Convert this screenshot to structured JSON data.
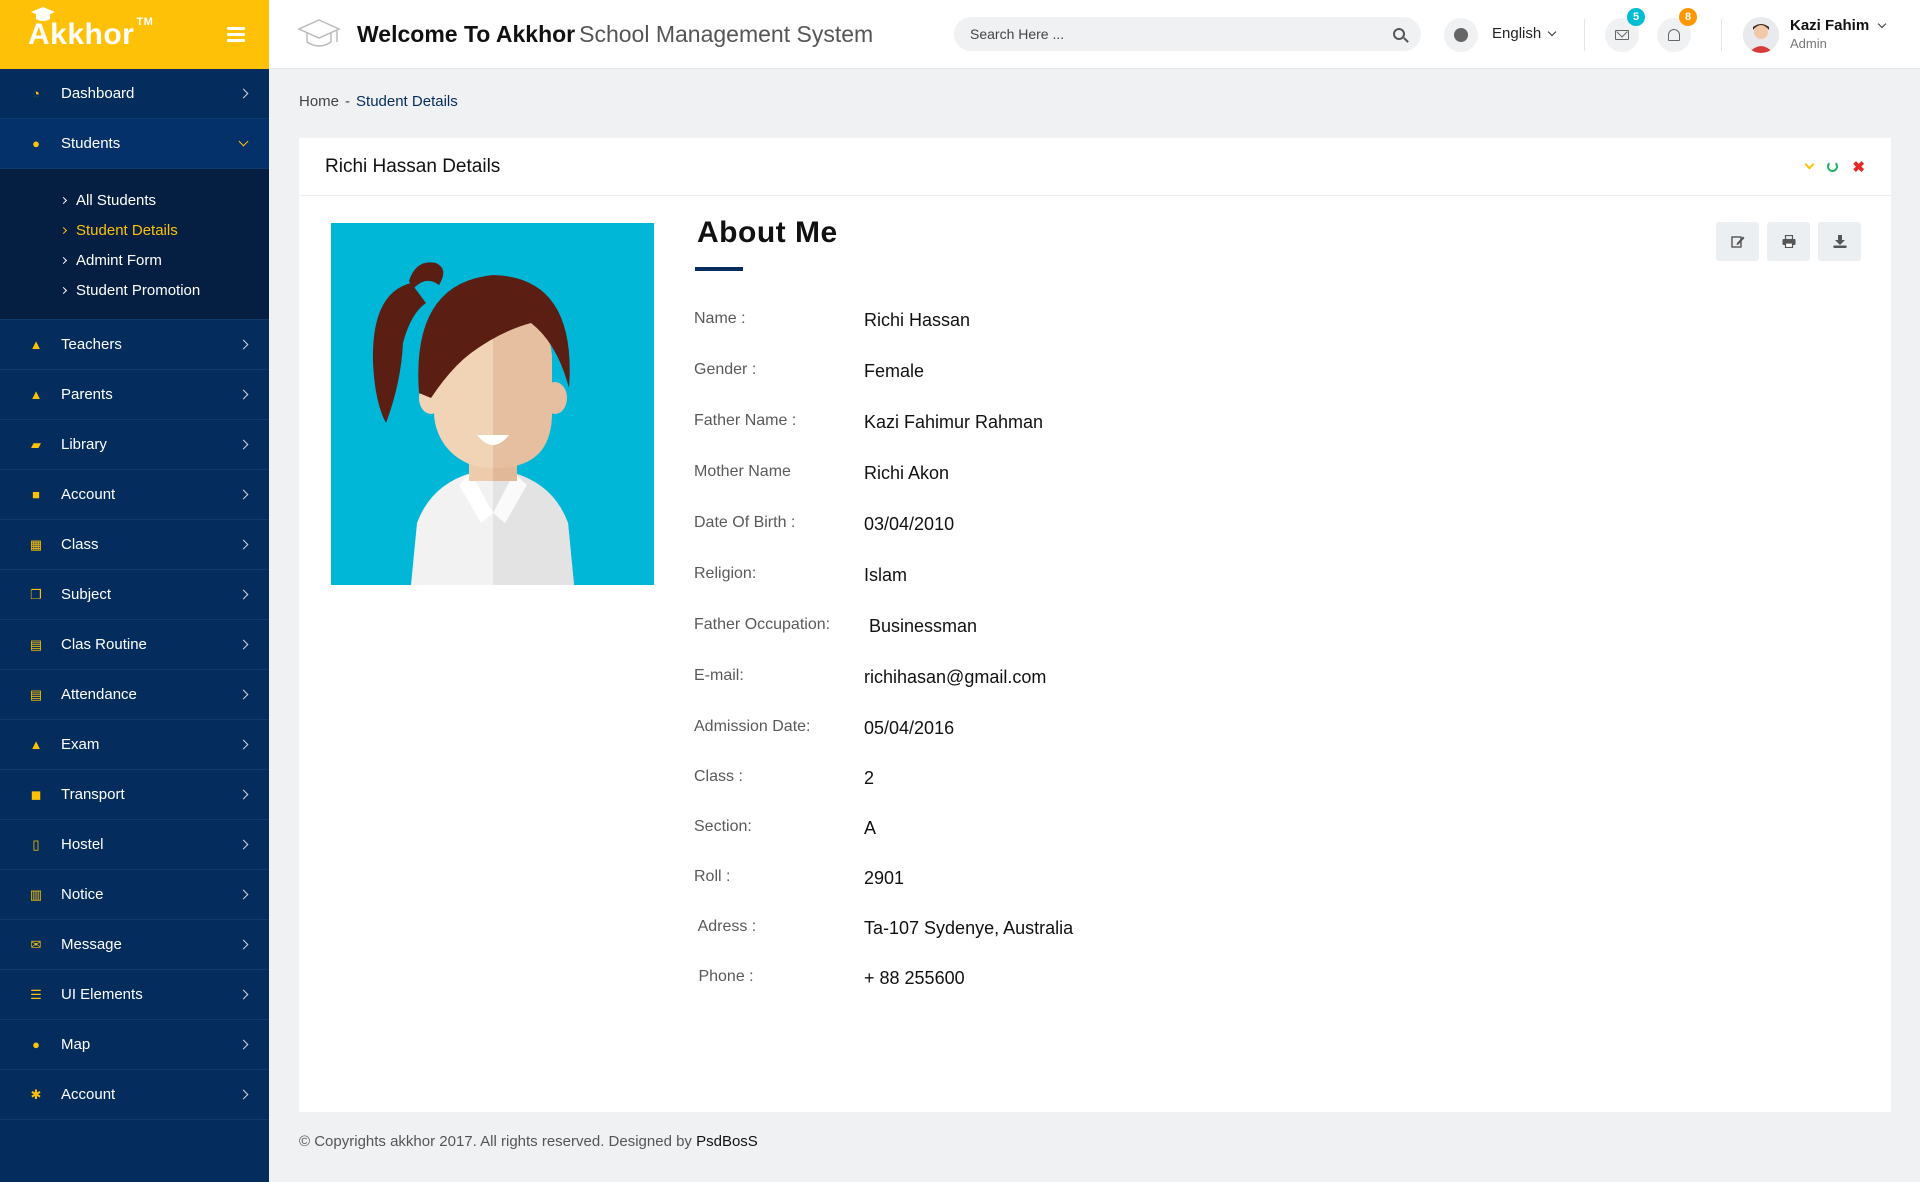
{
  "brand": {
    "name": "Akkhor",
    "tm": "TM"
  },
  "sidebar": {
    "items": [
      {
        "key": "dashboard",
        "label": "Dashboard",
        "icon": "dashboard-icon"
      },
      {
        "key": "students",
        "label": "Students",
        "icon": "students-icon",
        "open": true
      },
      {
        "key": "teachers",
        "label": "Teachers",
        "icon": "teachers-icon"
      },
      {
        "key": "parents",
        "label": "Parents",
        "icon": "parents-icon"
      },
      {
        "key": "library",
        "label": "Library",
        "icon": "book-icon"
      },
      {
        "key": "account",
        "label": "Account",
        "icon": "briefcase-icon"
      },
      {
        "key": "class",
        "label": "Class",
        "icon": "grid-icon"
      },
      {
        "key": "subject",
        "label": "Subject",
        "icon": "copy-icon"
      },
      {
        "key": "routine",
        "label": "Clas Routine",
        "icon": "calendar-icon"
      },
      {
        "key": "attendance",
        "label": "Attendance",
        "icon": "table-icon"
      },
      {
        "key": "exam",
        "label": "Exam",
        "icon": "graduation-cap-icon"
      },
      {
        "key": "transport",
        "label": "Transport",
        "icon": "car-icon"
      },
      {
        "key": "hostel",
        "label": "Hostel",
        "icon": "building-icon"
      },
      {
        "key": "notice",
        "label": "Notice",
        "icon": "map-icon"
      },
      {
        "key": "message",
        "label": "Message",
        "icon": "envelope-icon"
      },
      {
        "key": "ui",
        "label": "UI Elements",
        "icon": "list-icon"
      },
      {
        "key": "map",
        "label": "Map",
        "icon": "map-marker-icon"
      },
      {
        "key": "account2",
        "label": "Account",
        "icon": "gear-icon"
      }
    ],
    "sub_items": [
      {
        "label": "All Students",
        "active": false
      },
      {
        "label": "Student Details",
        "active": true
      },
      {
        "label": "Admint Form",
        "active": false
      },
      {
        "label": "Student Promotion",
        "active": false
      }
    ]
  },
  "header": {
    "welcome_bold": "Welcome To Akkhor",
    "welcome_light": "School Management System",
    "search_placeholder": "Search Here ...",
    "language": "English",
    "mail_count": "5",
    "notif_count": "8",
    "user_name": "Kazi Fahim",
    "user_role": "Admin"
  },
  "breadcrumb": {
    "home": "Home",
    "sep": "-",
    "current": "Student Details"
  },
  "card": {
    "title": "Richi Hassan Details",
    "about_title": "About  Me"
  },
  "details": [
    {
      "label": "Name :",
      "value": "Richi Hassan"
    },
    {
      "label": "Gender :",
      "value": "Female"
    },
    {
      "label": "Father Name :",
      "value": "Kazi Fahimur Rahman"
    },
    {
      "label": "Mother Name",
      "value": "Richi Akon"
    },
    {
      "label": "Date Of Birth :",
      "value": "03/04/2010"
    },
    {
      "label": "Religion:",
      "value": "Islam"
    },
    {
      "label": "Father Occupation:",
      "value": " Businessman"
    },
    {
      "label": "E-mail:",
      "value": "richihasan@gmail.com"
    },
    {
      "label": "Admission Date:",
      "value": "05/04/2016"
    },
    {
      "label": "Class :",
      "value": "2"
    },
    {
      "label": "Section:",
      "value": "A"
    },
    {
      "label": "Roll :",
      "value": "2901"
    },
    {
      "label": " Adress :",
      "value": "Ta-107 Sydenye, Australia"
    },
    {
      "label": " Phone :",
      "value": "+ 88 255600"
    }
  ],
  "footer": {
    "text": "© Copyrights akkhor 2017. All rights reserved. Designed by",
    "designer": "PsdBosS"
  },
  "colors": {
    "sidebar": "#042c5c",
    "brand": "#ffc107",
    "photo_bg": "#01b7d7",
    "refresh": "#20b561",
    "close": "#e62828"
  }
}
